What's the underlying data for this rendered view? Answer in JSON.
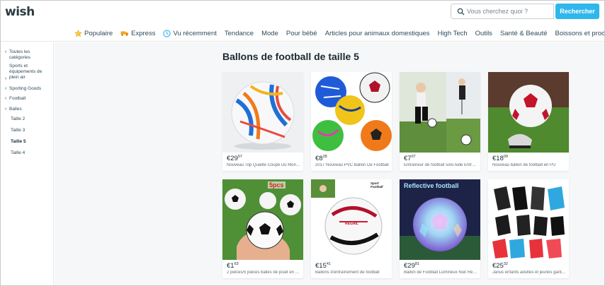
{
  "header": {
    "logo": "wish",
    "search_placeholder": "Vous cherchez quoi ?",
    "search_button": "Rechercher"
  },
  "nav": [
    {
      "label": "Populaire",
      "icon": "star-icon"
    },
    {
      "label": "Express",
      "icon": "truck-icon"
    },
    {
      "label": "Vu récemment",
      "icon": "clock-icon"
    },
    {
      "label": "Tendance"
    },
    {
      "label": "Mode"
    },
    {
      "label": "Pour bébé"
    },
    {
      "label": "Articles pour animaux domestiques"
    },
    {
      "label": "High Tech"
    },
    {
      "label": "Outils"
    },
    {
      "label": "Santé & Beauté"
    },
    {
      "label": "Boissons et produits"
    }
  ],
  "sidebar": {
    "all_categories": "Toutes les catégories",
    "sports": "Sports et équipements de plein air",
    "sporting_goods": "Sporting Goods",
    "football": "Football",
    "balls": "Balles",
    "sizes": [
      "Taille 2",
      "Taille 3",
      "Taille 5",
      "Taille 4"
    ],
    "active_size": "Taille 5"
  },
  "main": {
    "title": "Ballons de football de taille 5"
  },
  "products": [
    {
      "price_main": "€29",
      "price_cents": "57",
      "title": "Nouveau Top Qualité Coupe Du Monde Ballon de Football"
    },
    {
      "price_main": "€8",
      "price_cents": "28",
      "title": "2017 Nouveau PVC Ballon De Football"
    },
    {
      "price_main": "€7",
      "price_cents": "07",
      "title": "Entraîneur de football solo Aide Entraînement"
    },
    {
      "price_main": "€18",
      "price_cents": "09",
      "title": "Nouveau ballon de football en PU"
    },
    {
      "price_main": "€1",
      "price_cents": "63",
      "title": "2 pièces/5 pièces balles de jouet en mousse"
    },
    {
      "price_main": "€15",
      "price_cents": "41",
      "title": "Ballons d'entraînement de football"
    },
    {
      "price_main": "€29",
      "price_cents": "81",
      "title": "Ballon de Football Lumineux Nuit Réfléchissant"
    },
    {
      "price_main": "€25",
      "price_cents": "32",
      "title": "Janus enfants adultes et jeunes gants de gardien"
    }
  ],
  "image_text": {
    "p5": "5pcs",
    "p6": "Sport Football",
    "p6_brand": "REGAIL",
    "p7": "Reflective football"
  },
  "colors": {
    "accent": "#2fb7ec",
    "text": "#192a32",
    "nav_text": "#2f4b5a",
    "background": "#f6f7f8"
  }
}
